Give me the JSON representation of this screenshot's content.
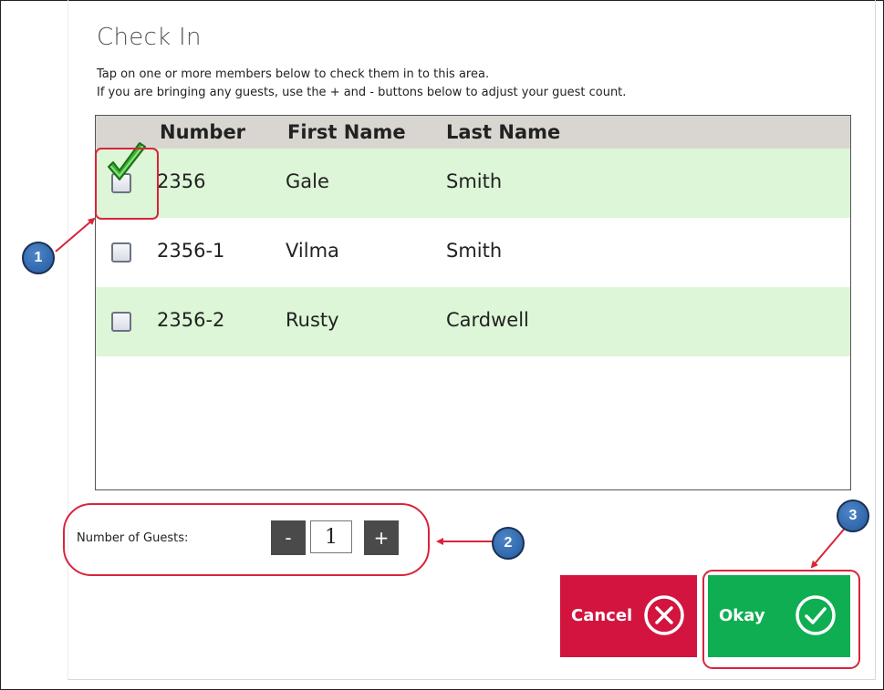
{
  "dialog": {
    "title": "Check In",
    "instruction_line1": "Tap on one or more members below to check them in to this area.",
    "instruction_line2": "If you are bringing any guests, use the + and - buttons below to adjust your guest count."
  },
  "table": {
    "columns": [
      "Number",
      "First Name",
      "Last Name"
    ],
    "rows": [
      {
        "number": "2356",
        "first_name": "Gale",
        "last_name": "Smith",
        "checked": true
      },
      {
        "number": "2356-1",
        "first_name": "Vilma",
        "last_name": "Smith",
        "checked": false
      },
      {
        "number": "2356-2",
        "first_name": "Rusty",
        "last_name": "Cardwell",
        "checked": false
      }
    ]
  },
  "guests": {
    "label": "Number of Guests:",
    "value": "1",
    "minus_label": "-",
    "plus_label": "+"
  },
  "buttons": {
    "cancel_label": "Cancel",
    "okay_label": "Okay"
  },
  "callouts": {
    "one": "1",
    "two": "2",
    "three": "3"
  },
  "colors": {
    "row_highlight": "#ddf6d7",
    "header_bg": "#d9d6d1",
    "cancel": "#d2143f",
    "okay": "#0fae52",
    "annotation_red": "#d9243a",
    "callout_blue": "#2f6bb3"
  },
  "icons": {
    "checked": "green-checkmark-icon",
    "cancel": "x-circle-icon",
    "okay": "check-circle-icon"
  }
}
